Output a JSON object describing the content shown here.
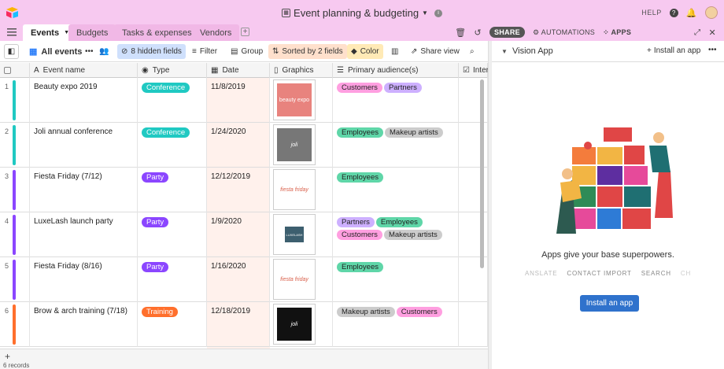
{
  "window": {
    "title": "Event planning & budgeting",
    "help": "HELP"
  },
  "tabs": [
    {
      "label": "Events",
      "active": true
    },
    {
      "label": "Budgets"
    },
    {
      "label": "Tasks & expenses"
    },
    {
      "label": "Vendors"
    }
  ],
  "actions": {
    "share": "SHARE",
    "automations": "AUTOMATIONS",
    "apps": "APPS"
  },
  "toolbar": {
    "view": "All events",
    "hidden_fields": "8 hidden fields",
    "filter": "Filter",
    "group": "Group",
    "sorted": "Sorted by 2 fields",
    "color": "Color",
    "share_view": "Share view"
  },
  "columns": [
    "Event name",
    "Type",
    "Date",
    "Graphics",
    "Primary audience(s)",
    "Inter"
  ],
  "rows": [
    {
      "num": "1",
      "name": "Beauty expo 2019",
      "type": "Conference",
      "date": "11/8/2019",
      "audience": [
        "Customers",
        "Partners"
      ],
      "graphic": "beauty expo",
      "color": "#20c9c2"
    },
    {
      "num": "2",
      "name": "Joli annual conference",
      "type": "Conference",
      "date": "1/24/2020",
      "audience": [
        "Employees",
        "Makeup artists"
      ],
      "graphic": "joli",
      "color": "#20c9c2"
    },
    {
      "num": "3",
      "name": "Fiesta Friday (7/12)",
      "type": "Party",
      "date": "12/12/2019",
      "audience": [
        "Employees"
      ],
      "graphic": "fiesta friday",
      "color": "#8b46ff"
    },
    {
      "num": "4",
      "name": "LuxeLash launch party",
      "type": "Party",
      "date": "1/9/2020",
      "audience": [
        "Partners",
        "Employees",
        "Customers",
        "Makeup artists"
      ],
      "graphic": "LUXELASH",
      "color": "#8b46ff"
    },
    {
      "num": "5",
      "name": "Fiesta Friday (8/16)",
      "type": "Party",
      "date": "1/16/2020",
      "audience": [
        "Employees"
      ],
      "graphic": "fiesta friday",
      "color": "#8b46ff"
    },
    {
      "num": "6",
      "name": "Brow & arch training (7/18)",
      "type": "Training",
      "date": "12/18/2019",
      "audience": [
        "Makeup artists",
        "Customers"
      ],
      "graphic": "joli",
      "color": "#ff6f2c"
    }
  ],
  "type_colors": {
    "Conference": "#20c9c2",
    "Party": "#8b46ff",
    "Training": "#ff6f2c"
  },
  "audience_colors": {
    "Customers": "#ff9fe0",
    "Partners": "#cdb0ff",
    "Employees": "#5fd6a8",
    "Makeup artists": "#cccccc"
  },
  "footer": {
    "records": "6 records"
  },
  "panel": {
    "title": "Vision App",
    "install": "Install an app",
    "tagline": "Apps give your base superpowers.",
    "features": [
      "ANSLATE",
      "CONTACT IMPORT",
      "SEARCH",
      "CH"
    ],
    "install_button": "Install an app"
  }
}
